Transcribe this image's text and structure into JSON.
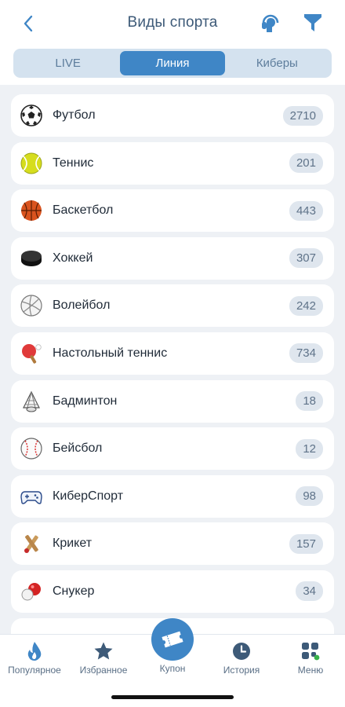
{
  "header": {
    "title": "Виды спорта",
    "back_icon": "chevron-left-icon",
    "support_icon": "headset-icon",
    "filter_icon": "filter-icon"
  },
  "tabs": [
    {
      "label": "LIVE",
      "active": false
    },
    {
      "label": "Линия",
      "active": true
    },
    {
      "label": "Киберы",
      "active": false
    }
  ],
  "sports": [
    {
      "name": "Футбол",
      "count": "2710",
      "icon": "soccer-ball-icon"
    },
    {
      "name": "Теннис",
      "count": "201",
      "icon": "tennis-ball-icon"
    },
    {
      "name": "Баскетбол",
      "count": "443",
      "icon": "basketball-icon"
    },
    {
      "name": "Хоккей",
      "count": "307",
      "icon": "hockey-puck-icon"
    },
    {
      "name": "Волейбол",
      "count": "242",
      "icon": "volleyball-icon"
    },
    {
      "name": "Настольный теннис",
      "count": "734",
      "icon": "ping-pong-icon"
    },
    {
      "name": "Бадминтон",
      "count": "18",
      "icon": "shuttlecock-icon"
    },
    {
      "name": "Бейсбол",
      "count": "12",
      "icon": "baseball-icon"
    },
    {
      "name": "КиберСпорт",
      "count": "98",
      "icon": "gamepad-icon"
    },
    {
      "name": "Крикет",
      "count": "157",
      "icon": "cricket-icon"
    },
    {
      "name": "Снукер",
      "count": "34",
      "icon": "snooker-icon"
    }
  ],
  "tabbar": {
    "popular": "Популярное",
    "favorites": "Избранное",
    "coupon": "Купон",
    "history": "История",
    "menu": "Меню"
  },
  "colors": {
    "accent": "#3f86c6",
    "title": "#3d5a78",
    "background": "#eef1f5"
  }
}
